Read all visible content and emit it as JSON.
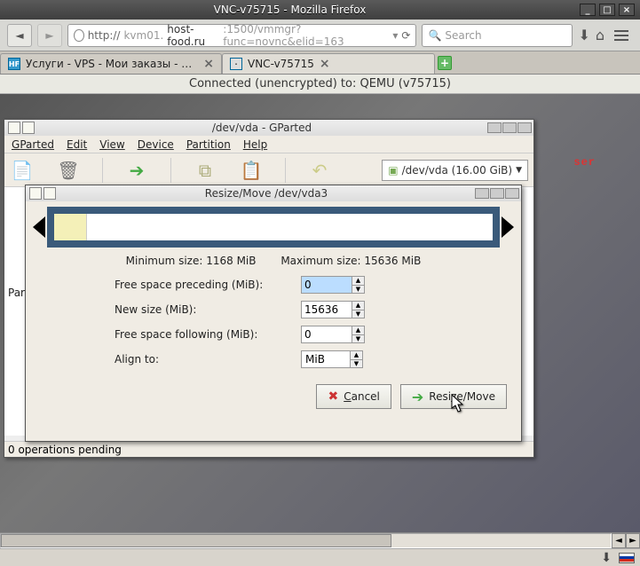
{
  "firefox": {
    "window_title": "VNC-v75715 - Mozilla Firefox",
    "url_prefix": "http://",
    "url_host_light": "kvm01.",
    "url_host": "host-food.ru",
    "url_port_path": ":1500/vmmgr?func=novnc&elid=163",
    "search_placeholder": "Search",
    "tabs": [
      {
        "label": "Услуги - VPS - Мои заказы - manager.h…"
      },
      {
        "label": "VNC-v75715"
      }
    ]
  },
  "vnc": {
    "status": "Connected (unencrypted) to: QEMU (v75715)",
    "user_text": "ser"
  },
  "gparted": {
    "title": "/dev/vda - GParted",
    "menu": {
      "m1": "GParted",
      "m2": "Edit",
      "m3": "View",
      "m4": "Device",
      "m5": "Partition",
      "m6": "Help"
    },
    "device_selector": "/dev/vda  (16.00 GiB)",
    "col_header": "Par",
    "status": "0 operations pending"
  },
  "dialog": {
    "title": "Resize/Move /dev/vda3",
    "min_label": "Minimum size: 1168 MiB",
    "max_label": "Maximum size: 15636 MiB",
    "preceding_label": "Free space preceding (MiB):",
    "preceding_value": "0",
    "newsize_label": "New size (MiB):",
    "newsize_value": "15636",
    "following_label": "Free space following (MiB):",
    "following_value": "0",
    "align_label": "Align to:",
    "align_value": "MiB",
    "cancel": "Cancel",
    "resize": "Resize/Move"
  }
}
